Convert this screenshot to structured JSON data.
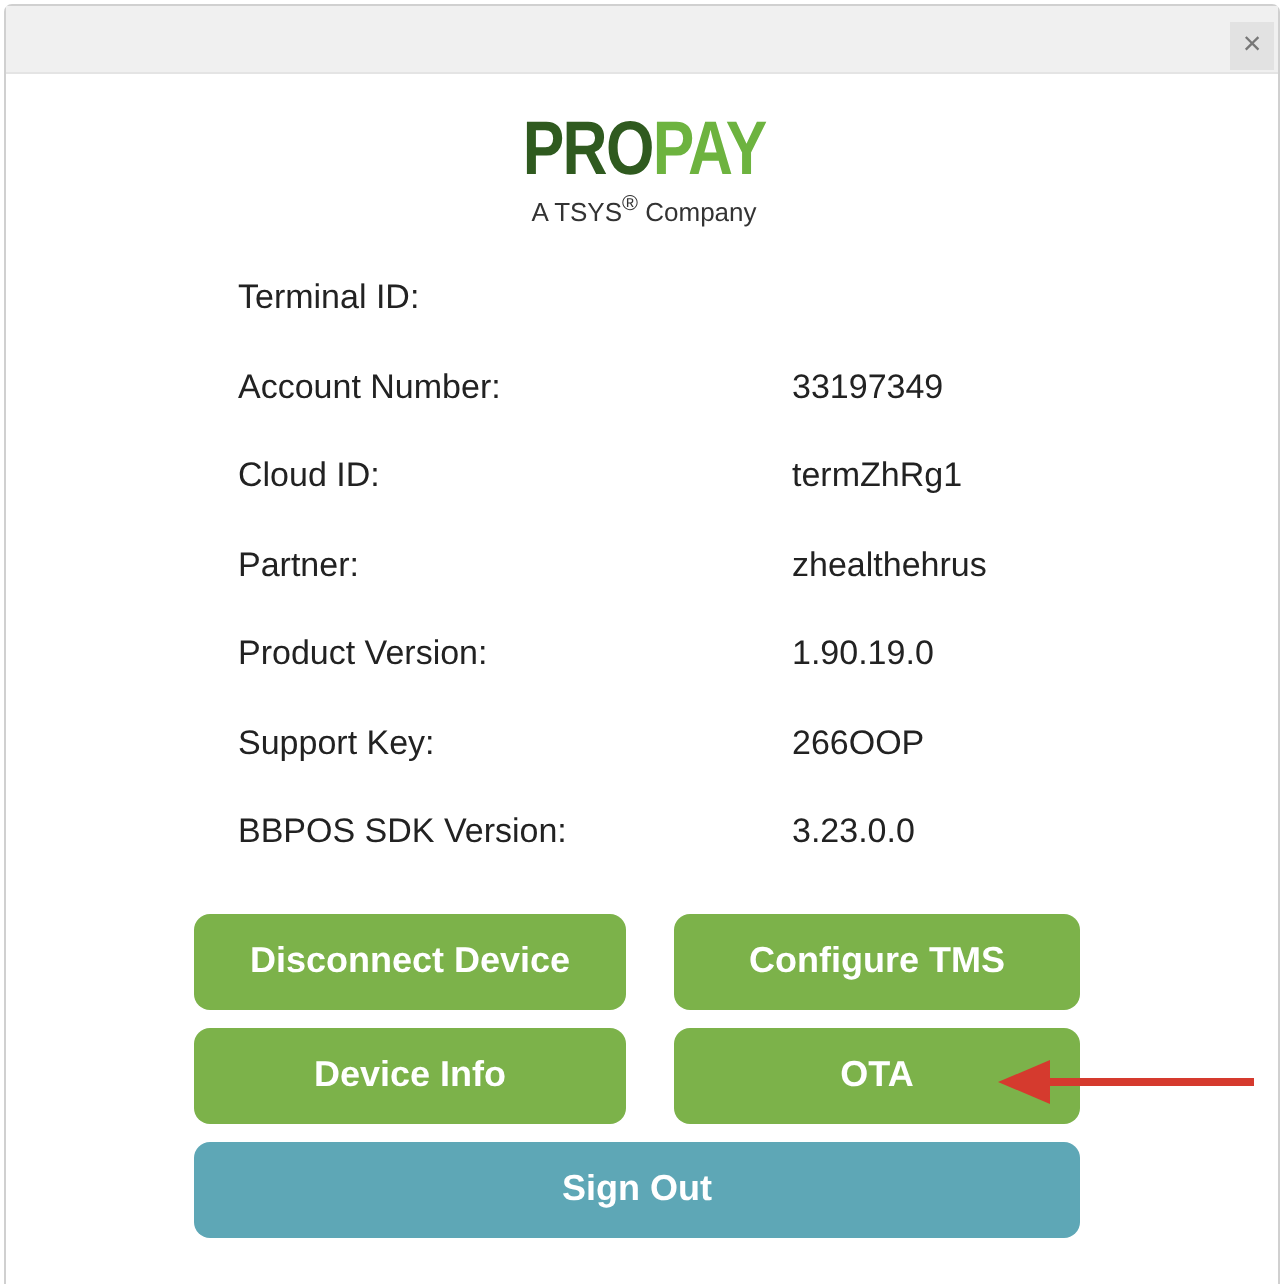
{
  "dialog": {
    "close": "×"
  },
  "logo": {
    "left": "PRO",
    "right": "PAY",
    "tagline": "A TSYS$^{®}$ Company"
  },
  "fields": [
    {
      "label": "Terminal ID:"
    },
    {
      "label": "Account Number:",
      "value": "33197349"
    },
    {
      "label": "Cloud ID:",
      "value": "termZhRg1"
    },
    {
      "label": "Partner:",
      "value": "zhealthehrus"
    },
    {
      "label": "Product Version:",
      "value": "1.90.19.0"
    },
    {
      "label": "Support Key:",
      "value": "266OOP"
    },
    {
      "label": "BBPOS SDK Version:",
      "value": "3.23.0.0"
    }
  ],
  "buttons": [
    {
      "label": "Disconnect Device",
      "kind": "action"
    },
    {
      "label": "Configure TMS",
      "kind": "action"
    },
    {
      "label": "Device Info",
      "kind": "action"
    },
    {
      "label": "OTA",
      "kind": "action"
    },
    {
      "label": "Sign Out",
      "kind": "signout"
    }
  ],
  "annotation": {
    "kind": "arrow"
  }
}
